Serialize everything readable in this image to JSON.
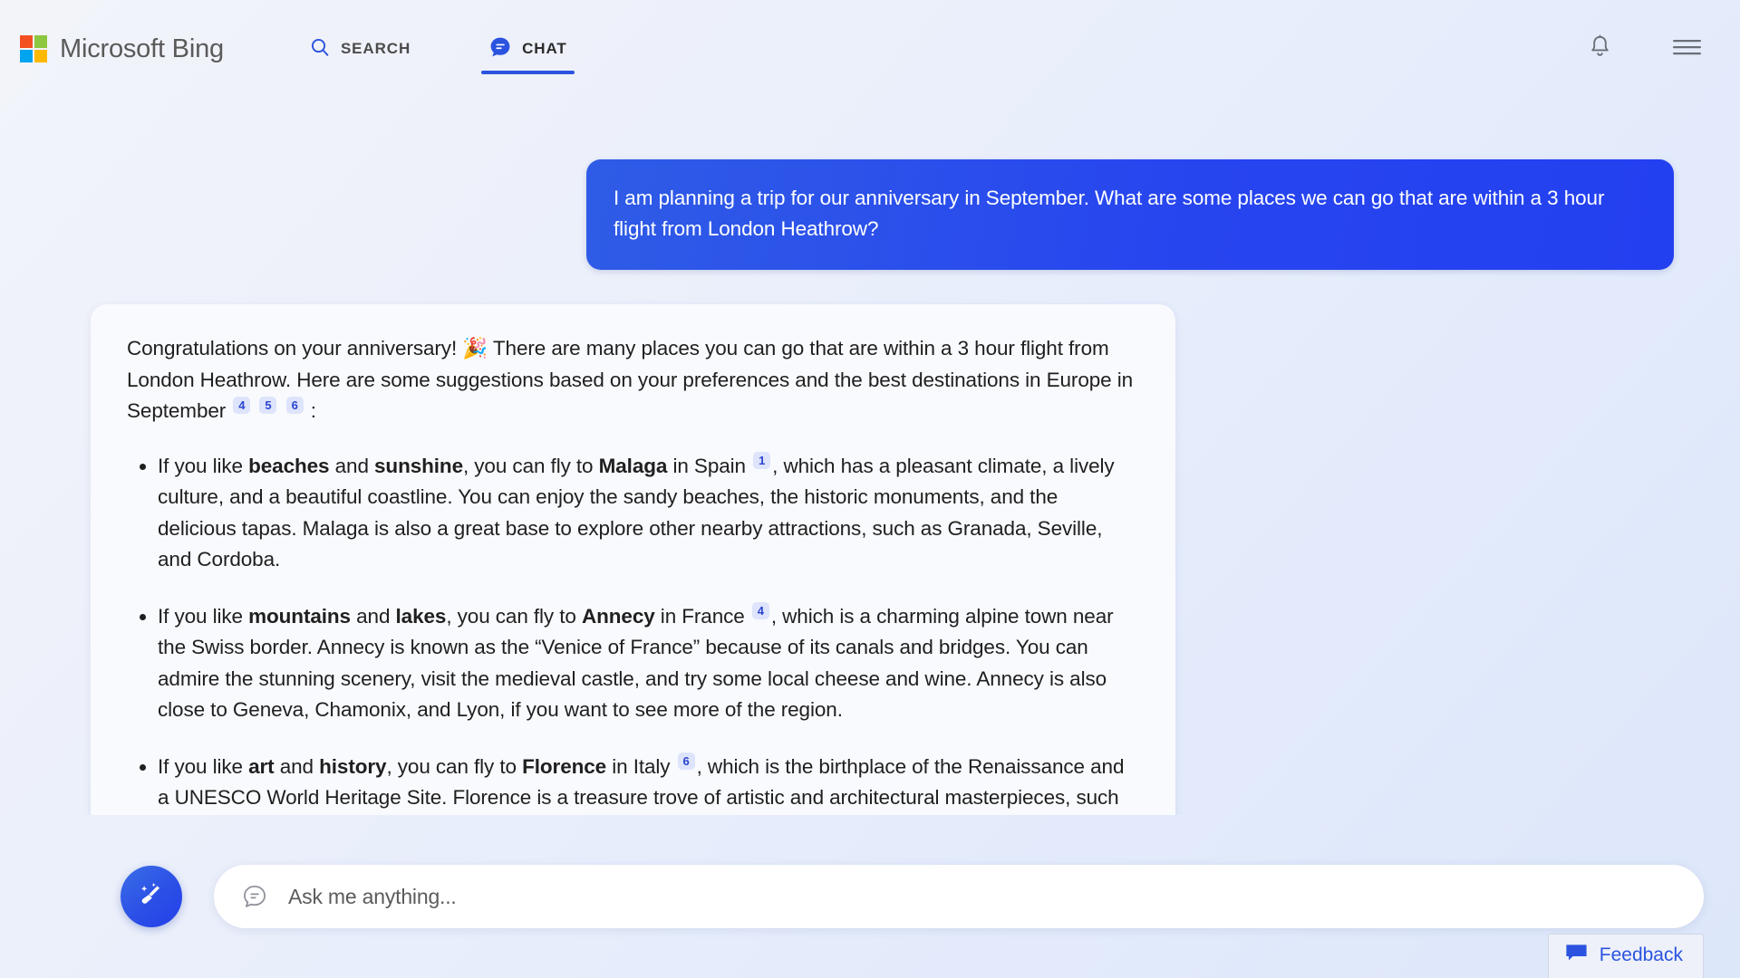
{
  "header": {
    "brand": "Microsoft Bing",
    "logo_colors": [
      "#f25022",
      "#8dc63f",
      "#00a4ef",
      "#ffb900"
    ],
    "tabs": [
      {
        "label": "SEARCH",
        "icon": "search-icon",
        "active": false
      },
      {
        "label": "CHAT",
        "icon": "chat-bubble-icon",
        "active": true
      }
    ],
    "notifications_icon": "bell-icon",
    "menu_icon": "hamburger-menu-icon"
  },
  "conversation": {
    "user_message": "I am planning a trip for our anniversary in September. What are some places we can go that are within a 3 hour flight from London Heathrow?",
    "assistant": {
      "intro_part1": "Congratulations on your anniversary! 🎉 There are many places you can go that are within a 3 hour flight from London Heathrow. Here are some suggestions based on your preferences and the best destinations in Europe in September",
      "intro_citations": [
        "4",
        "5",
        "6"
      ],
      "intro_part2": ":",
      "bullets": [
        {
          "lead": "If you like ",
          "bold1": "beaches",
          "mid1": " and ",
          "bold2": "sunshine",
          "mid2": ", you can fly to ",
          "place": "Malaga",
          "country": " in Spain",
          "citation": "1",
          "rest": ", which has a pleasant climate, a lively culture, and a beautiful coastline. You can enjoy the sandy beaches, the historic monuments, and the delicious tapas. Malaga is also a great base to explore other nearby attractions, such as Granada, Seville, and Cordoba."
        },
        {
          "lead": "If you like ",
          "bold1": "mountains",
          "mid1": " and ",
          "bold2": "lakes",
          "mid2": ", you can fly to ",
          "place": "Annecy",
          "country": " in France",
          "citation": "4",
          "rest": ", which is a charming alpine town near the Swiss border. Annecy is known as the “Venice of France” because of its canals and bridges. You can admire the stunning scenery, visit the medieval castle, and try some local cheese and wine. Annecy is also close to Geneva, Chamonix, and Lyon, if you want to see more of the region."
        },
        {
          "lead": "If you like ",
          "bold1": "art",
          "mid1": " and ",
          "bold2": "history",
          "mid2": ", you can fly to ",
          "place": "Florence",
          "country": " in Italy",
          "citation": "6",
          "rest": ", which is the birthplace of the Renaissance and a UNESCO World Heritage Site. Florence is a treasure trove of artistic and architectural masterpieces, such as the Duomo, the Uffizi Gallery, and the Ponte Vecchio. You can also explore the Tuscan countryside, taste the famous gelato, and shop for leather goods."
        }
      ]
    }
  },
  "composer": {
    "new_topic_icon": "broom-icon",
    "input_icon": "chat-bubble-outline-icon",
    "placeholder": "Ask me anything...",
    "value": ""
  },
  "feedback": {
    "label": "Feedback",
    "icon": "feedback-bubble-icon"
  },
  "colors": {
    "accent_blue": "#2b53e0",
    "user_bubble_blue": "#2745ef",
    "citation_bg": "#dde4fb",
    "citation_text": "#2b44d0",
    "page_bg_start": "#f2f4fa",
    "page_bg_end": "#dde7fa"
  }
}
